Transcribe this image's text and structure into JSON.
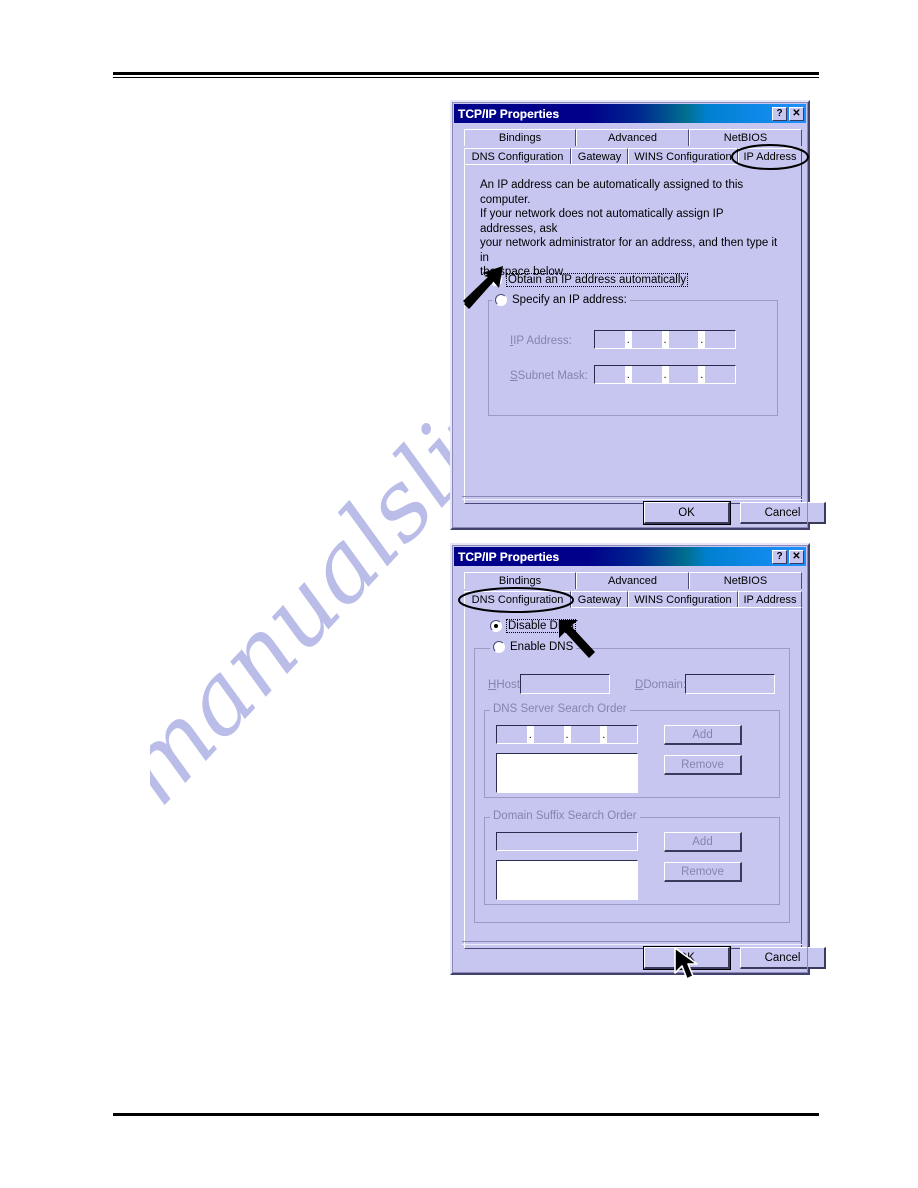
{
  "page": {
    "watermark_text": "manualslive.com"
  },
  "dialog1": {
    "title": "TCP/IP Properties",
    "help_button": "?",
    "close_button": "✕",
    "tabs_row1": [
      "Bindings",
      "Advanced",
      "NetBIOS"
    ],
    "tabs_row2": [
      "DNS Configuration",
      "Gateway",
      "WINS Configuration",
      "IP Address"
    ],
    "selected_tab": "IP Address",
    "description": "An IP address can be automatically assigned to this computer.\nIf your network does not automatically assign IP addresses, ask\nyour network administrator for an address, and then type it in\nthe space below.",
    "radio_auto": "Obtain an IP address automatically",
    "radio_auto_selected": true,
    "radio_specify": "Specify an IP address:",
    "radio_specify_selected": false,
    "label_ip_address": "IP Address:",
    "label_subnet_mask": "Subnet Mask:",
    "ip_address_value": "",
    "subnet_mask_value": "",
    "ip_separator": ".",
    "ok_label": "OK",
    "cancel_label": "Cancel"
  },
  "dialog2": {
    "title": "TCP/IP Properties",
    "help_button": "?",
    "close_button": "✕",
    "tabs_row1": [
      "Bindings",
      "Advanced",
      "NetBIOS"
    ],
    "tabs_row2": [
      "DNS Configuration",
      "Gateway",
      "WINS Configuration",
      "IP Address"
    ],
    "selected_tab": "DNS Configuration",
    "radio_disable": "Disable DNS",
    "radio_disable_selected": true,
    "radio_enable": "Enable DNS",
    "radio_enable_selected": false,
    "label_host": "Host:",
    "label_domain": "Domain:",
    "host_value": "",
    "domain_value": "",
    "group_dns_search": "DNS Server Search Order",
    "group_domain_suffix": "Domain Suffix Search Order",
    "dns_add_label": "Add",
    "dns_remove_label": "Remove",
    "suffix_add_label": "Add",
    "suffix_remove_label": "Remove",
    "dns_entry_value": "",
    "suffix_entry_value": "",
    "ip_separator": ".",
    "ok_label": "OK",
    "cancel_label": "Cancel"
  },
  "annotations": {
    "ellipse_ip_address_tab": "IP Address",
    "ellipse_dns_configuration_tab": "DNS Configuration",
    "arrow_to_obtain_ip": "Obtain an IP address automatically",
    "arrow_to_disable_dns": "Disable DNS",
    "cursor_on_ok": "OK"
  }
}
